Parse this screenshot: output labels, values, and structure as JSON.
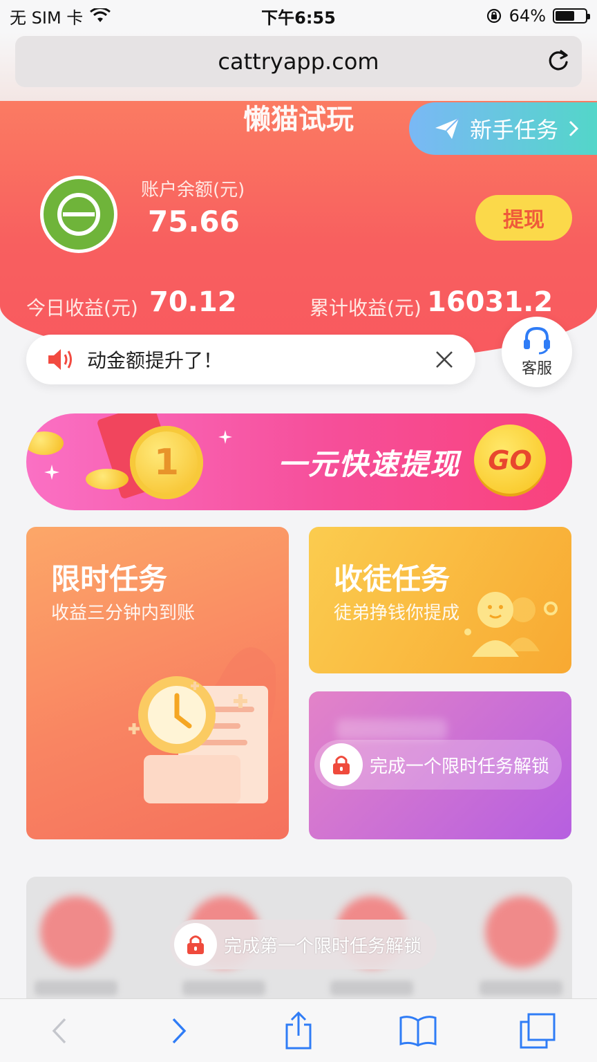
{
  "status_bar": {
    "carrier": "无 SIM 卡",
    "time": "下午6:55",
    "battery": "64%"
  },
  "browser": {
    "url": "cattryapp.com"
  },
  "header": {
    "app_title": "懒猫试玩",
    "newbie_task": "新手任务",
    "balance_label": "账户余额(元)",
    "balance_value": "75.66",
    "withdraw_button": "提现",
    "today_label": "今日收益(元)",
    "today_value": "70.12",
    "total_label": "累计收益(元)",
    "total_value": "16031.2"
  },
  "notice": {
    "text": "动金额提升了！"
  },
  "customer_service": {
    "label": "客服"
  },
  "banner": {
    "title": "一元快速提现",
    "coin_number": "1",
    "go_label": "GO"
  },
  "cards": {
    "limited": {
      "title": "限时任务",
      "subtitle": "收益三分钟内到账"
    },
    "apprentice": {
      "title": "收徒任务",
      "subtitle": "徒弟挣钱你提成"
    },
    "locked": {
      "unlock_text": "完成一个限时任务解锁"
    }
  },
  "bottom": {
    "unlock_text": "完成第一个限时任务解锁"
  },
  "colors": {
    "header_red": "#f85f5f",
    "banner_pink": "#f64f9a",
    "withdraw_yellow": "#fbd94a",
    "limited_orange": "#f98562",
    "apprentice_yellow": "#f8a932",
    "locked_purple": "#b65fe0",
    "toolbar_blue": "#2f7cf6"
  }
}
